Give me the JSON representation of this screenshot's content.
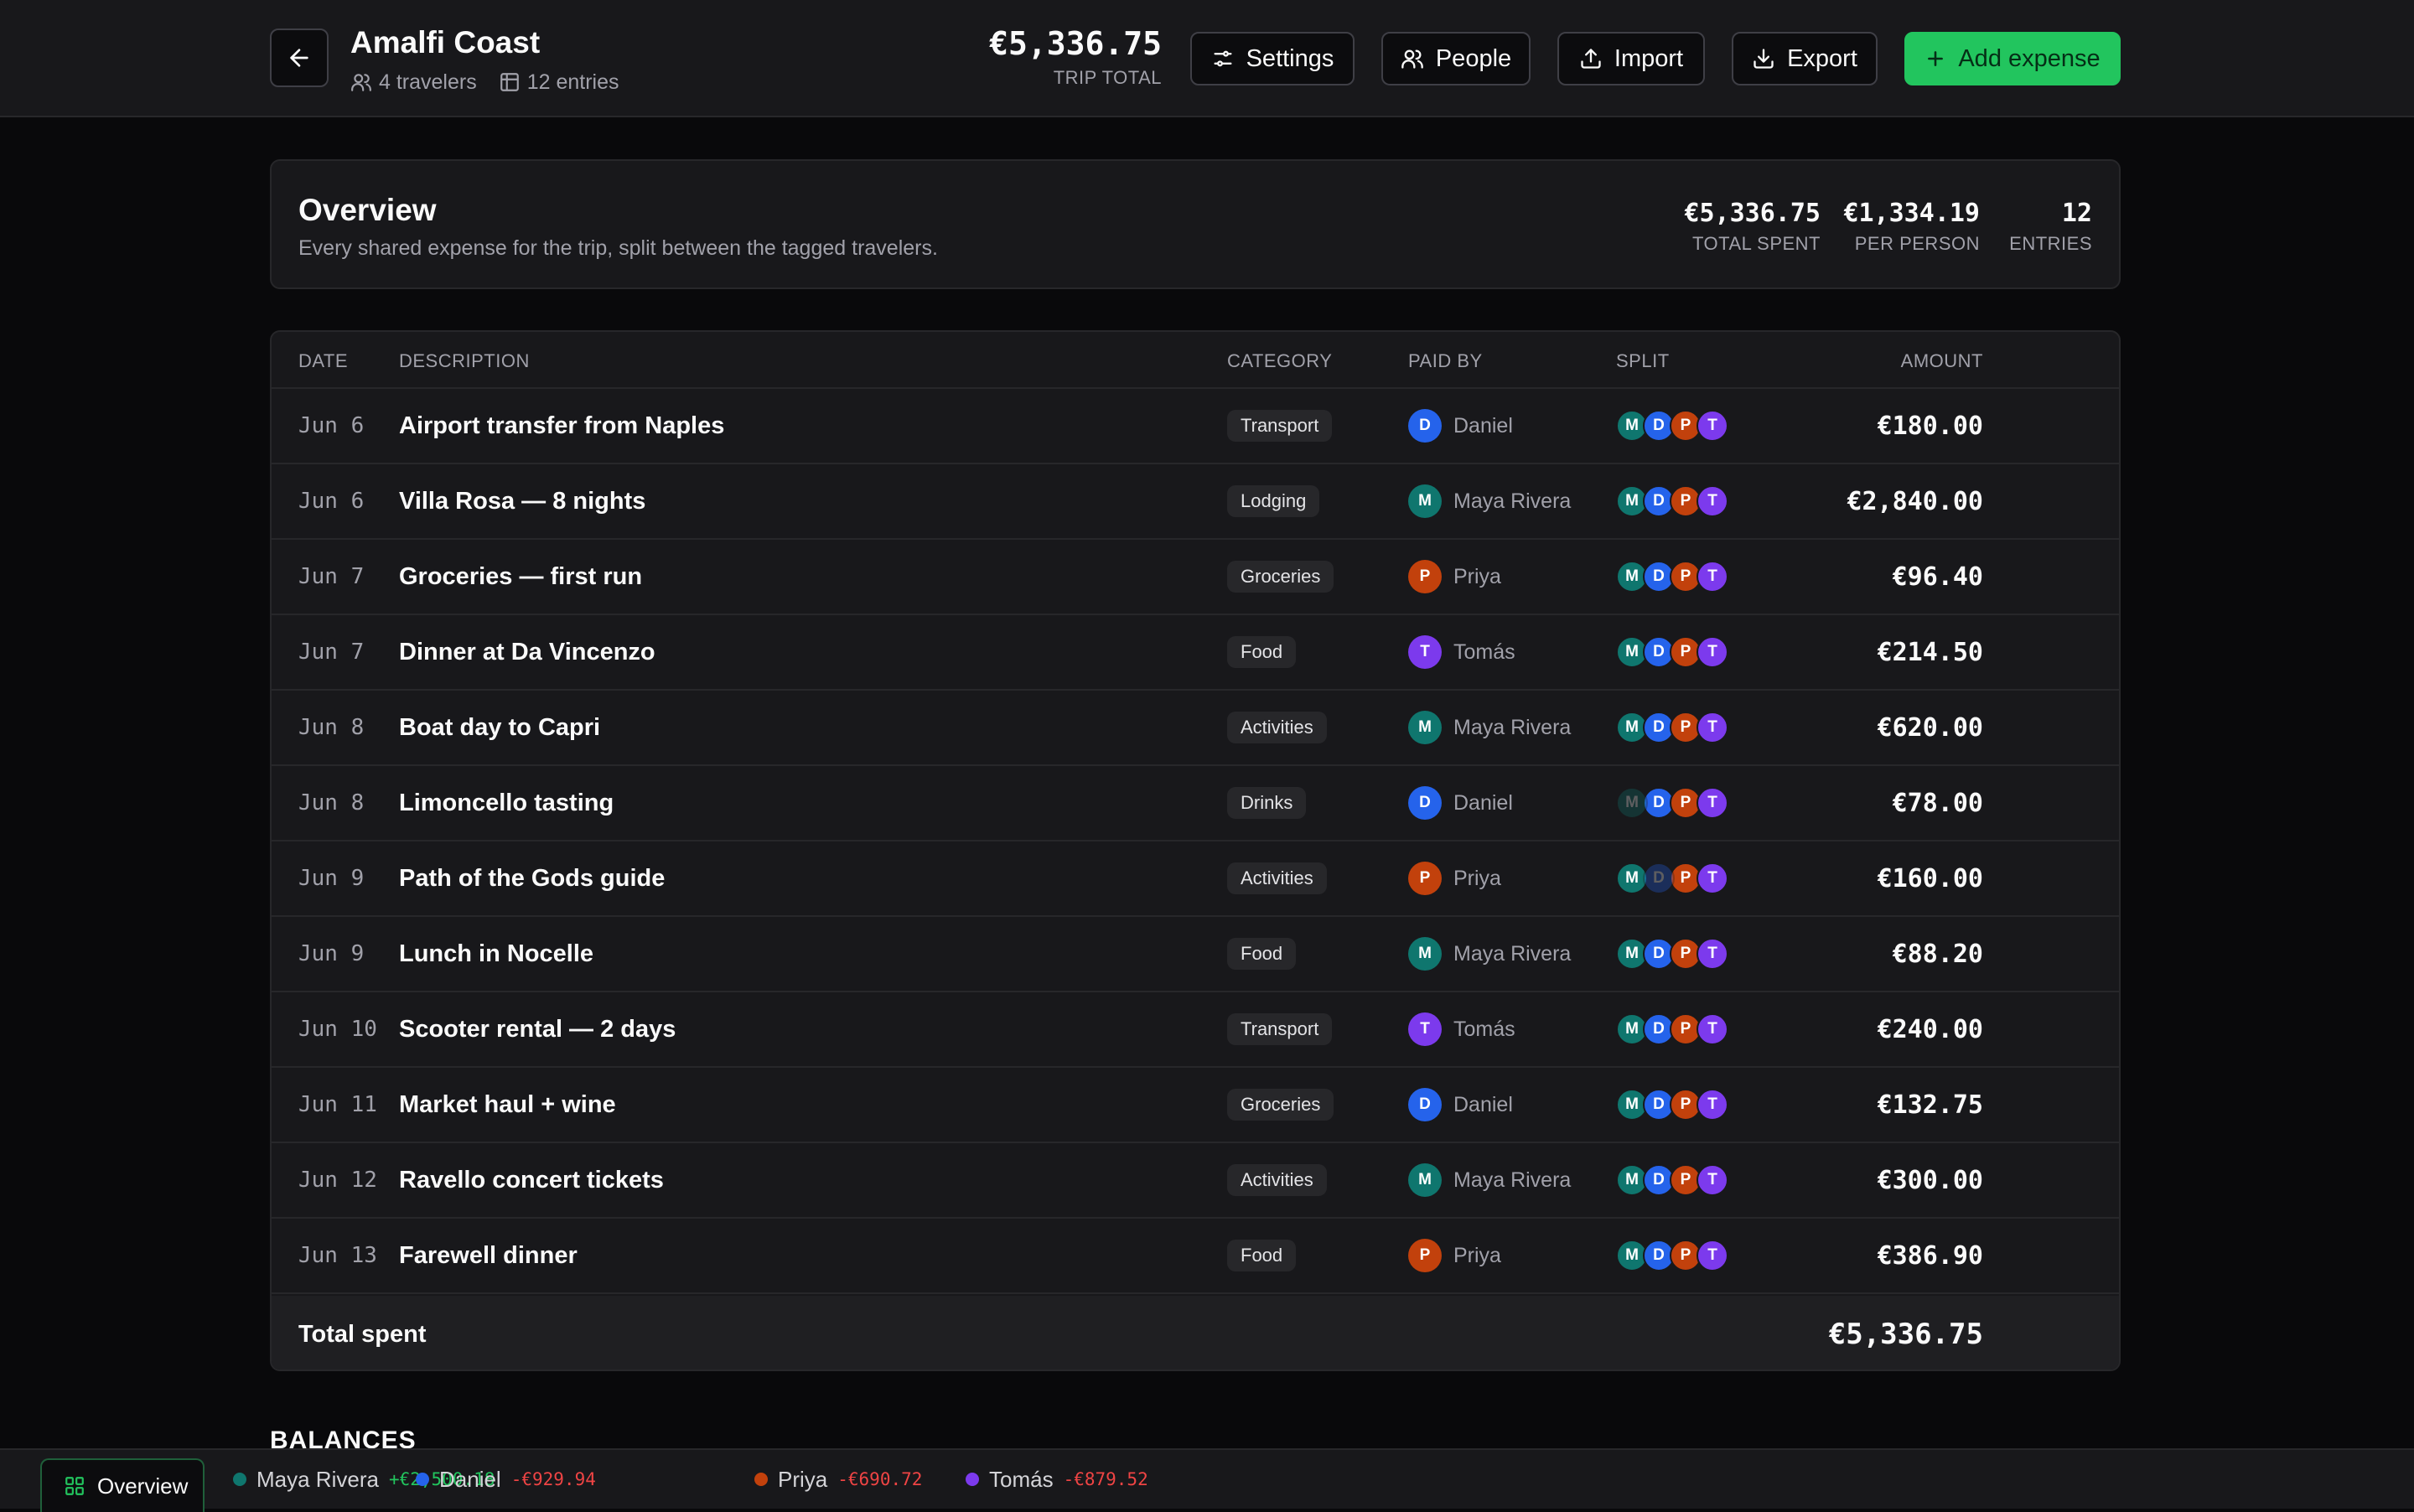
{
  "header": {
    "title": "Amalfi Coast",
    "travelers": "4 travelers",
    "entries": "12 entries",
    "trip_total": "€5,336.75",
    "trip_total_label": "TRIP TOTAL",
    "buttons": {
      "settings": "Settings",
      "people": "People",
      "import": "Import",
      "export": "Export",
      "add": "Add expense"
    }
  },
  "overview": {
    "title": "Overview",
    "subtitle": "Every shared expense for the trip, split between the tagged travelers.",
    "stats": [
      {
        "value": "€5,336.75",
        "label": "TOTAL SPENT"
      },
      {
        "value": "€1,334.19",
        "label": "PER PERSON"
      },
      {
        "value": "12",
        "label": "ENTRIES"
      }
    ]
  },
  "table": {
    "columns": {
      "date": "DATE",
      "description": "DESCRIPTION",
      "category": "CATEGORY",
      "paid_by": "PAID BY",
      "split": "SPLIT",
      "amount": "AMOUNT"
    },
    "rows": [
      {
        "date": "Jun 6",
        "desc": "Airport transfer from Naples",
        "cat": "Transport",
        "paid": "Daniel",
        "paid_initial": "D",
        "paid_color": "#2563eb",
        "amount": "€180.00",
        "excluded": []
      },
      {
        "date": "Jun 6",
        "desc": "Villa Rosa — 8 nights",
        "cat": "Lodging",
        "paid": "Maya Rivera",
        "paid_initial": "M",
        "paid_color": "#0f766e",
        "amount": "€2,840.00",
        "excluded": []
      },
      {
        "date": "Jun 7",
        "desc": "Groceries — first run",
        "cat": "Groceries",
        "paid": "Priya",
        "paid_initial": "P",
        "paid_color": "#c2410c",
        "amount": "€96.40",
        "excluded": []
      },
      {
        "date": "Jun 7",
        "desc": "Dinner at Da Vincenzo",
        "cat": "Food",
        "paid": "Tomás",
        "paid_initial": "T",
        "paid_color": "#7c3aed",
        "amount": "€214.50",
        "excluded": []
      },
      {
        "date": "Jun 8",
        "desc": "Boat day to Capri",
        "cat": "Activities",
        "paid": "Maya Rivera",
        "paid_initial": "M",
        "paid_color": "#0f766e",
        "amount": "€620.00",
        "excluded": []
      },
      {
        "date": "Jun 8",
        "desc": "Limoncello tasting",
        "cat": "Drinks",
        "paid": "Daniel",
        "paid_initial": "D",
        "paid_color": "#2563eb",
        "amount": "€78.00",
        "excluded": [
          "M"
        ]
      },
      {
        "date": "Jun 9",
        "desc": "Path of the Gods guide",
        "cat": "Activities",
        "paid": "Priya",
        "paid_initial": "P",
        "paid_color": "#c2410c",
        "amount": "€160.00",
        "excluded": [
          "D"
        ]
      },
      {
        "date": "Jun 9",
        "desc": "Lunch in Nocelle",
        "cat": "Food",
        "paid": "Maya Rivera",
        "paid_initial": "M",
        "paid_color": "#0f766e",
        "amount": "€88.20",
        "excluded": []
      },
      {
        "date": "Jun 10",
        "desc": "Scooter rental — 2 days",
        "cat": "Transport",
        "paid": "Tomás",
        "paid_initial": "T",
        "paid_color": "#7c3aed",
        "amount": "€240.00",
        "excluded": []
      },
      {
        "date": "Jun 11",
        "desc": "Market haul + wine",
        "cat": "Groceries",
        "paid": "Daniel",
        "paid_initial": "D",
        "paid_color": "#2563eb",
        "amount": "€132.75",
        "excluded": []
      },
      {
        "date": "Jun 12",
        "desc": "Ravello concert tickets",
        "cat": "Activities",
        "paid": "Maya Rivera",
        "paid_initial": "M",
        "paid_color": "#0f766e",
        "amount": "€300.00",
        "excluded": []
      },
      {
        "date": "Jun 13",
        "desc": "Farewell dinner",
        "cat": "Food",
        "paid": "Priya",
        "paid_initial": "P",
        "paid_color": "#c2410c",
        "amount": "€386.90",
        "excluded": []
      }
    ],
    "total_label": "Total spent",
    "total_amount": "€5,336.75"
  },
  "split_people": [
    {
      "initial": "M",
      "color": "#0f766e"
    },
    {
      "initial": "D",
      "color": "#2563eb"
    },
    {
      "initial": "P",
      "color": "#c2410c"
    },
    {
      "initial": "T",
      "color": "#7c3aed"
    }
  ],
  "balances_title": "BALANCES",
  "bottom_bar": {
    "tab": "Overview",
    "balances": [
      {
        "name": "Maya Rivera",
        "value": "+€2,500.18",
        "color": "#0f766e",
        "value_color": "#22c55e"
      },
      {
        "name": "Daniel",
        "value": "-€929.94",
        "color": "#2563eb",
        "value_color": "#ef4444"
      },
      {
        "name": "Priya",
        "value": "-€690.72",
        "color": "#c2410c",
        "value_color": "#ef4444"
      },
      {
        "name": "Tomás",
        "value": "-€879.52",
        "color": "#7c3aed",
        "value_color": "#ef4444"
      }
    ]
  },
  "colors": {
    "accent": "#22c55e",
    "background": "#09090b",
    "surface": "#18181b",
    "negative": "#ef4444"
  }
}
